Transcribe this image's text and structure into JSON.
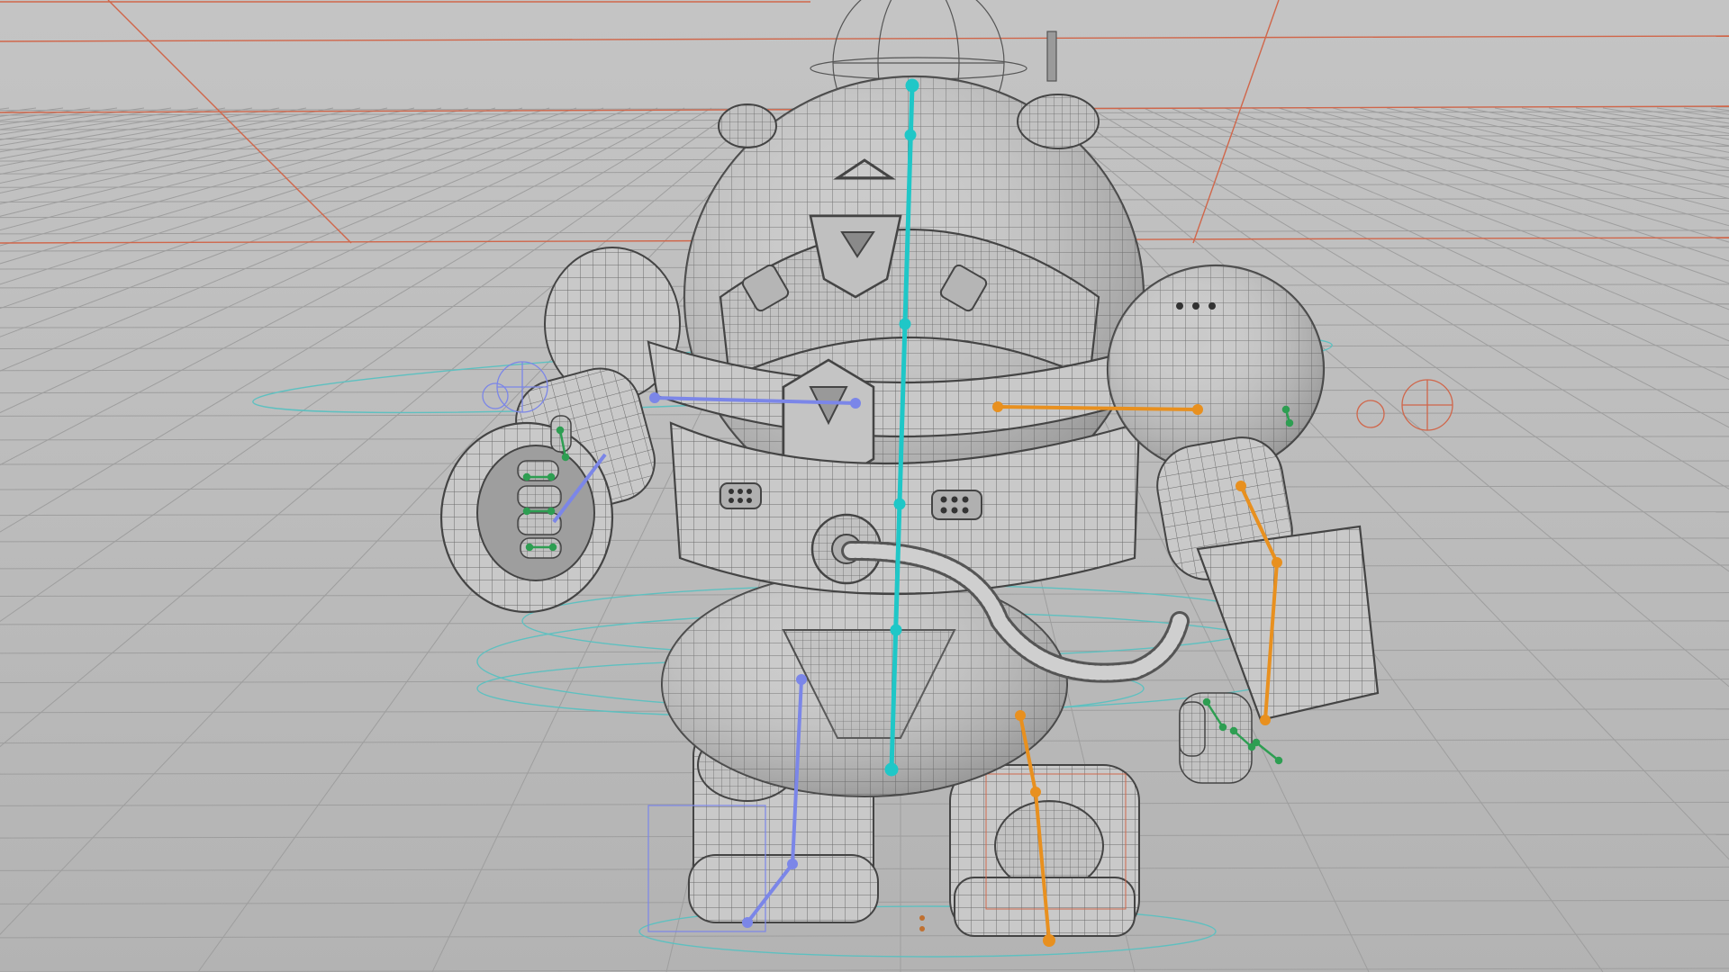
{
  "viewport": {
    "background_top": "#c4c4c4",
    "background_bottom": "#b3b3b3",
    "grid_color": "#9e9e9e",
    "axis_color": "#d0664a"
  },
  "rig": {
    "spine_color": "#1fc7c7",
    "left_chain_color": "#7b86e8",
    "right_chain_color": "#e8901f",
    "finger_joint_color": "#2e9e52",
    "control_color": "#5ec0c0"
  },
  "model": {
    "wire_color": "#5a5a5a",
    "shell_color": "#c8c8c8",
    "shade_color": "#9a9a9a",
    "icon": "mech-suit-wireframe"
  }
}
